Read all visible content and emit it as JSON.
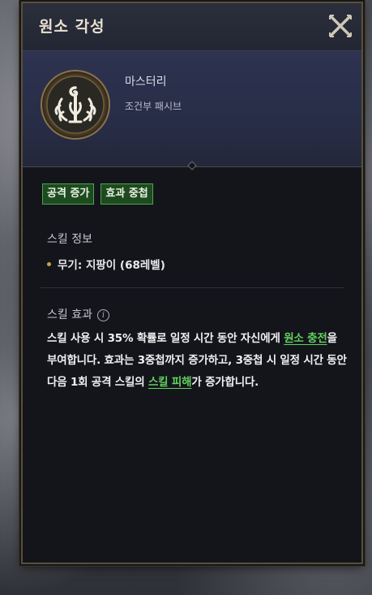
{
  "window": {
    "title": "원소 각성",
    "close_icon": "close-x-icon"
  },
  "skill": {
    "icon": "element-awakening-skill-icon",
    "name": "마스터리",
    "type": "조건부 패시브"
  },
  "tags": [
    "공격 증가",
    "효과 중첩"
  ],
  "info": {
    "title": "스킬 정보",
    "weapon_line": "무기: 지팡이 (68레벨)"
  },
  "effect": {
    "title": "스킬 효과",
    "desc_part1": "스킬 사용 시 35% 확률로 일정 시간 동안 자신에게 ",
    "keyword1": "원소 충전",
    "desc_part2": "을 부여합니다. 효과는 3중첩까지 증가하고, 3중첩 시 일정 시간 동안 다음 1회 공격 스킬의 ",
    "keyword2": "스킬 피해",
    "desc_part3": "가 증가합니다."
  },
  "colors": {
    "keyword": "#62d15e",
    "tag_bg": "#1e4a1f",
    "tag_border": "#4ea24f",
    "frame_gold": "#5a4f3a"
  }
}
